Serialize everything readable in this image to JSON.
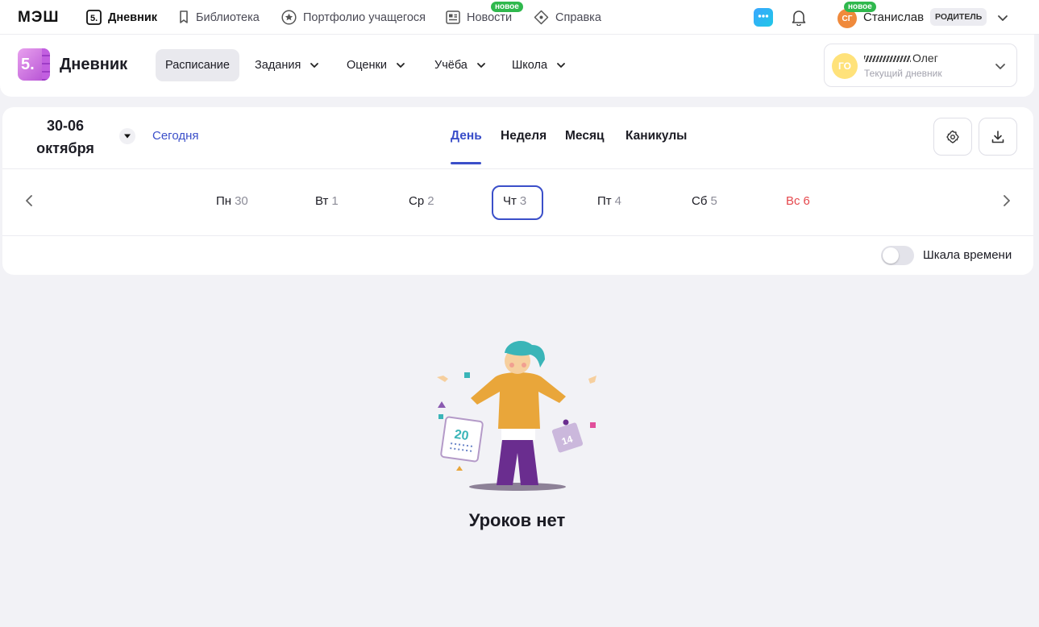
{
  "topbar": {
    "brand": "МЭШ",
    "nav": [
      {
        "label": "Дневник",
        "icon": "diary-5-icon"
      },
      {
        "label": "Библиотека",
        "icon": "bookmark-icon"
      },
      {
        "label": "Портфолио учащегося",
        "icon": "star-circle-icon"
      },
      {
        "label": "Новости",
        "icon": "news-icon",
        "badge": "новое"
      },
      {
        "label": "Справка",
        "icon": "help-diamond-icon"
      }
    ],
    "user": {
      "initials": "СГ",
      "name": "Станислав",
      "role": "РОДИТЕЛЬ",
      "badge": "новое"
    }
  },
  "navbar": {
    "logo": "5.",
    "title": "Дневник",
    "menu": [
      {
        "label": "Расписание"
      },
      {
        "label": "Задания"
      },
      {
        "label": "Оценки"
      },
      {
        "label": "Учёба"
      },
      {
        "label": "Школа"
      }
    ],
    "diary": {
      "initials": "ГО",
      "name": "Олег",
      "subtitle": "Текущий дневник"
    }
  },
  "schedule": {
    "date_range_line1": "30-06",
    "date_range_line2": "октября",
    "today": "Сегодня",
    "tabs": [
      "День",
      "Неделя",
      "Месяц",
      "Каникулы"
    ],
    "days": [
      {
        "name": "Пн",
        "num": "30"
      },
      {
        "name": "Вт",
        "num": "1"
      },
      {
        "name": "Ср",
        "num": "2"
      },
      {
        "name": "Чт",
        "num": "3"
      },
      {
        "name": "Пт",
        "num": "4"
      },
      {
        "name": "Сб",
        "num": "5"
      },
      {
        "name": "Вс",
        "num": "6"
      }
    ],
    "timescale_label": "Шкала времени"
  },
  "empty": {
    "message": "Уроков нет",
    "calendar_left": "20",
    "calendar_right": "14"
  },
  "colors": {
    "accent": "#3b4fc9",
    "sunday": "#e5484d",
    "new_badge": "#2fb84d"
  }
}
